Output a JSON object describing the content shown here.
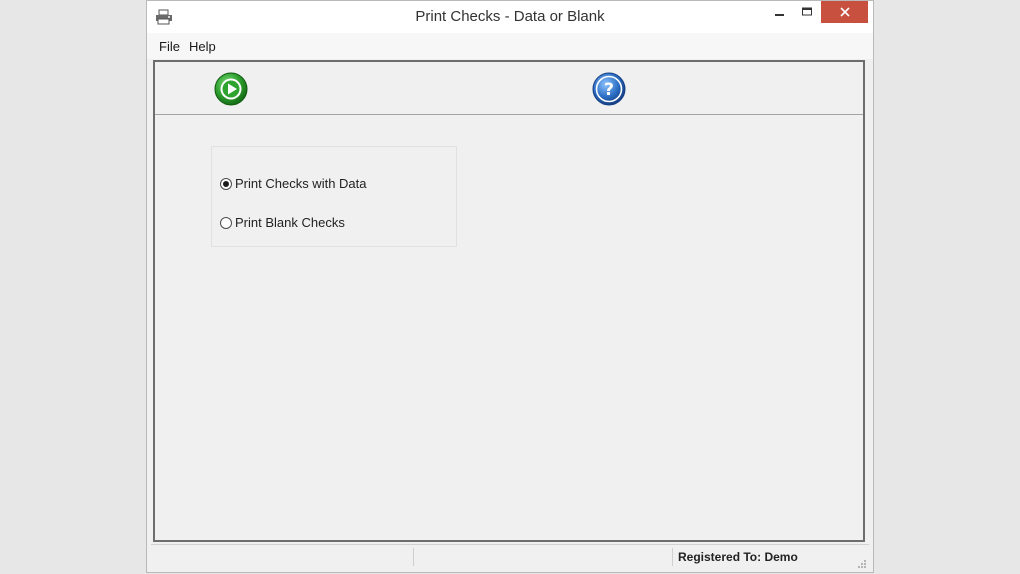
{
  "window": {
    "title": "Print Checks - Data or Blank",
    "app_icon": "printer-icon",
    "controls": {
      "minimize": "minimize-icon",
      "maximize": "maximize-icon",
      "close": "close-icon"
    }
  },
  "menu": {
    "items": [
      {
        "label": "File"
      },
      {
        "label": "Help"
      }
    ]
  },
  "toolbar": {
    "buttons": [
      {
        "icon": "play-icon",
        "color": "#2e9e2e"
      },
      {
        "icon": "help-icon",
        "color": "#2c6fc4"
      }
    ]
  },
  "options": {
    "items": [
      {
        "label": "Print Checks with Data",
        "selected": true
      },
      {
        "label": "Print Blank Checks",
        "selected": false
      }
    ]
  },
  "statusbar": {
    "panels": [
      "",
      "",
      "Registered To: Demo"
    ]
  },
  "colors": {
    "close_button": "#c7503e",
    "window_bg": "#f0f0f0"
  }
}
